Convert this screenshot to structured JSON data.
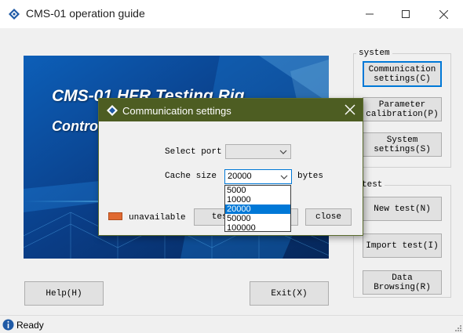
{
  "window": {
    "title": "CMS-01 operation guide",
    "minimize_icon": "minimize-icon",
    "maximize_icon": "maximize-icon",
    "close_icon": "close-icon"
  },
  "banner": {
    "title": "CMS-01 HFR Testing Rig",
    "subtitle": "Control"
  },
  "system_group": {
    "label": "system",
    "buttons": [
      {
        "label": "Communication\nsettings(C)"
      },
      {
        "label": "Parameter\ncalibration(P)"
      },
      {
        "label": "System\nsettings(S)"
      }
    ]
  },
  "test_group": {
    "label": "test",
    "buttons": [
      {
        "label": "New test(N)"
      },
      {
        "label": "Import test(I)"
      },
      {
        "label": "Data\nBrowsing(R)"
      }
    ]
  },
  "bottom_buttons": {
    "help": "Help(H)",
    "exit": "Exit(X)"
  },
  "dialog": {
    "title": "Communication settings",
    "select_port_label": "Select port",
    "select_port_value": "",
    "cache_size_label": "Cache size",
    "cache_size_value": "20000",
    "cache_unit": "bytes",
    "cache_options": [
      "5000",
      "10000",
      "20000",
      "50000",
      "100000"
    ],
    "selected_option": "20000",
    "status_text": "unavailable",
    "status_color": "#e06a32",
    "test_button": "test",
    "close_button": "close"
  },
  "statusbar": {
    "text": "Ready"
  }
}
